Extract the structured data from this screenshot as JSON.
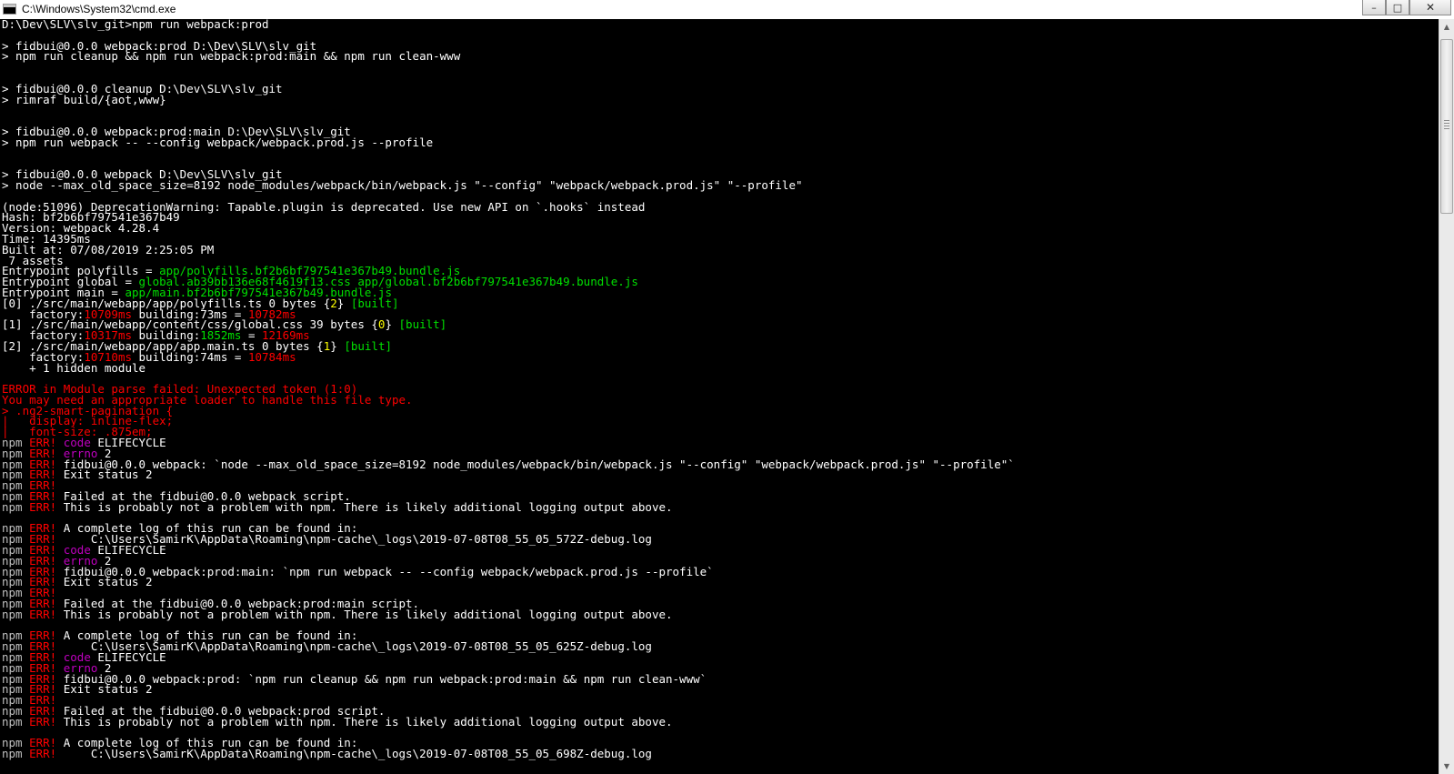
{
  "window": {
    "title": "C:\\Windows\\System32\\cmd.exe",
    "icon": "cmd-console-icon",
    "controls": {
      "minimize": "–",
      "maximize": "□",
      "close": "✕"
    }
  },
  "colors": {
    "background": "#000000",
    "default_text": "#c0c0c0",
    "bright_text": "#ffffff",
    "green": "#00e000",
    "red": "#ff0000",
    "yellow": "#ffff00",
    "magenta": "#c000c0"
  },
  "console": {
    "lines": [
      [
        [
          "w",
          "D:\\Dev\\SLV\\slv_git>npm run webpack:prod"
        ]
      ],
      [],
      [
        [
          "w",
          "> fidbui@0.0.0 webpack:prod D:\\Dev\\SLV\\slv_git"
        ]
      ],
      [
        [
          "w",
          "> npm run cleanup && npm run webpack:prod:main && npm run clean-www"
        ]
      ],
      [],
      [],
      [
        [
          "w",
          "> fidbui@0.0.0 cleanup D:\\Dev\\SLV\\slv_git"
        ]
      ],
      [
        [
          "w",
          "> rimraf build/{aot,www}"
        ]
      ],
      [],
      [],
      [
        [
          "w",
          "> fidbui@0.0.0 webpack:prod:main D:\\Dev\\SLV\\slv_git"
        ]
      ],
      [
        [
          "w",
          "> npm run webpack -- --config webpack/webpack.prod.js --profile"
        ]
      ],
      [],
      [],
      [
        [
          "w",
          "> fidbui@0.0.0 webpack D:\\Dev\\SLV\\slv_git"
        ]
      ],
      [
        [
          "w",
          "> node --max_old_space_size=8192 node_modules/webpack/bin/webpack.js \"--config\" \"webpack/webpack.prod.js\" \"--profile\""
        ]
      ],
      [],
      [
        [
          "w",
          "(node:51096) DeprecationWarning: Tapable.plugin is deprecated. Use new API on `.hooks` instead"
        ]
      ],
      [
        [
          "w",
          "Hash: bf2b6bf797541e367b49"
        ]
      ],
      [
        [
          "w",
          "Version: webpack 4.28.4"
        ]
      ],
      [
        [
          "w",
          "Time: 14395ms"
        ]
      ],
      [
        [
          "w",
          "Built at: 07/08/2019 2:25:05 PM"
        ]
      ],
      [
        [
          "w",
          " 7 assets"
        ]
      ],
      [
        [
          "w",
          "Entrypoint polyfills = "
        ],
        [
          "g",
          "app/polyfills.bf2b6bf797541e367b49.bundle.js"
        ]
      ],
      [
        [
          "w",
          "Entrypoint global = "
        ],
        [
          "g",
          "global.ab39bb136e68f4619f13.css app/global.bf2b6bf797541e367b49.bundle.js"
        ]
      ],
      [
        [
          "w",
          "Entrypoint main = "
        ],
        [
          "g",
          "app/main.bf2b6bf797541e367b49.bundle.js"
        ]
      ],
      [
        [
          "w",
          "[0] ./src/main/webapp/app/polyfills.ts 0 bytes {"
        ],
        [
          "y",
          "2"
        ],
        [
          "w",
          "} "
        ],
        [
          "g",
          "[built]"
        ]
      ],
      [
        [
          "w",
          "    factory:"
        ],
        [
          "r",
          "10709ms"
        ],
        [
          "w",
          " building:73ms = "
        ],
        [
          "r",
          "10782ms"
        ]
      ],
      [
        [
          "w",
          "[1] ./src/main/webapp/content/css/global.css 39 bytes {"
        ],
        [
          "y",
          "0"
        ],
        [
          "w",
          "} "
        ],
        [
          "g",
          "[built]"
        ]
      ],
      [
        [
          "w",
          "    factory:"
        ],
        [
          "r",
          "10317ms"
        ],
        [
          "w",
          " building:"
        ],
        [
          "g",
          "1852ms"
        ],
        [
          "w",
          " = "
        ],
        [
          "r",
          "12169ms"
        ]
      ],
      [
        [
          "w",
          "[2] ./src/main/webapp/app/app.main.ts 0 bytes {"
        ],
        [
          "y",
          "1"
        ],
        [
          "w",
          "} "
        ],
        [
          "g",
          "[built]"
        ]
      ],
      [
        [
          "w",
          "    factory:"
        ],
        [
          "r",
          "10710ms"
        ],
        [
          "w",
          " building:74ms = "
        ],
        [
          "r",
          "10784ms"
        ]
      ],
      [
        [
          "w",
          "    + 1 hidden module"
        ]
      ],
      [],
      [
        [
          "r",
          "ERROR in Module parse failed: Unexpected token (1:0)"
        ]
      ],
      [
        [
          "r",
          "You may need an appropriate loader to handle this file type."
        ]
      ],
      [
        [
          "r",
          "> .ng2-smart-pagination {"
        ]
      ],
      [
        [
          "r",
          "|   display: inline-flex;"
        ]
      ],
      [
        [
          "r",
          "|   font-size: .875em;"
        ]
      ],
      [
        [
          "gy",
          "npm "
        ],
        [
          "r",
          "ERR!"
        ],
        [
          "w",
          " "
        ],
        [
          "m",
          "code"
        ],
        [
          "w",
          " ELIFECYCLE"
        ]
      ],
      [
        [
          "gy",
          "npm "
        ],
        [
          "r",
          "ERR!"
        ],
        [
          "w",
          " "
        ],
        [
          "m",
          "errno"
        ],
        [
          "w",
          " 2"
        ]
      ],
      [
        [
          "gy",
          "npm "
        ],
        [
          "r",
          "ERR!"
        ],
        [
          "w",
          " fidbui@0.0.0 webpack: `node --max_old_space_size=8192 node_modules/webpack/bin/webpack.js \"--config\" \"webpack/webpack.prod.js\" \"--profile\"`"
        ]
      ],
      [
        [
          "gy",
          "npm "
        ],
        [
          "r",
          "ERR!"
        ],
        [
          "w",
          " Exit status 2"
        ]
      ],
      [
        [
          "gy",
          "npm "
        ],
        [
          "r",
          "ERR!"
        ]
      ],
      [
        [
          "gy",
          "npm "
        ],
        [
          "r",
          "ERR!"
        ],
        [
          "w",
          " Failed at the fidbui@0.0.0 webpack script."
        ]
      ],
      [
        [
          "gy",
          "npm "
        ],
        [
          "r",
          "ERR!"
        ],
        [
          "w",
          " This is probably not a problem with npm. There is likely additional logging output above."
        ]
      ],
      [],
      [
        [
          "gy",
          "npm "
        ],
        [
          "r",
          "ERR!"
        ],
        [
          "w",
          " A complete log of this run can be found in:"
        ]
      ],
      [
        [
          "gy",
          "npm "
        ],
        [
          "r",
          "ERR!"
        ],
        [
          "w",
          "     C:\\Users\\SamirK\\AppData\\Roaming\\npm-cache\\_logs\\2019-07-08T08_55_05_572Z-debug.log"
        ]
      ],
      [
        [
          "gy",
          "npm "
        ],
        [
          "r",
          "ERR!"
        ],
        [
          "w",
          " "
        ],
        [
          "m",
          "code"
        ],
        [
          "w",
          " ELIFECYCLE"
        ]
      ],
      [
        [
          "gy",
          "npm "
        ],
        [
          "r",
          "ERR!"
        ],
        [
          "w",
          " "
        ],
        [
          "m",
          "errno"
        ],
        [
          "w",
          " 2"
        ]
      ],
      [
        [
          "gy",
          "npm "
        ],
        [
          "r",
          "ERR!"
        ],
        [
          "w",
          " fidbui@0.0.0 webpack:prod:main: `npm run webpack -- --config webpack/webpack.prod.js --profile`"
        ]
      ],
      [
        [
          "gy",
          "npm "
        ],
        [
          "r",
          "ERR!"
        ],
        [
          "w",
          " Exit status 2"
        ]
      ],
      [
        [
          "gy",
          "npm "
        ],
        [
          "r",
          "ERR!"
        ]
      ],
      [
        [
          "gy",
          "npm "
        ],
        [
          "r",
          "ERR!"
        ],
        [
          "w",
          " Failed at the fidbui@0.0.0 webpack:prod:main script."
        ]
      ],
      [
        [
          "gy",
          "npm "
        ],
        [
          "r",
          "ERR!"
        ],
        [
          "w",
          " This is probably not a problem with npm. There is likely additional logging output above."
        ]
      ],
      [],
      [
        [
          "gy",
          "npm "
        ],
        [
          "r",
          "ERR!"
        ],
        [
          "w",
          " A complete log of this run can be found in:"
        ]
      ],
      [
        [
          "gy",
          "npm "
        ],
        [
          "r",
          "ERR!"
        ],
        [
          "w",
          "     C:\\Users\\SamirK\\AppData\\Roaming\\npm-cache\\_logs\\2019-07-08T08_55_05_625Z-debug.log"
        ]
      ],
      [
        [
          "gy",
          "npm "
        ],
        [
          "r",
          "ERR!"
        ],
        [
          "w",
          " "
        ],
        [
          "m",
          "code"
        ],
        [
          "w",
          " ELIFECYCLE"
        ]
      ],
      [
        [
          "gy",
          "npm "
        ],
        [
          "r",
          "ERR!"
        ],
        [
          "w",
          " "
        ],
        [
          "m",
          "errno"
        ],
        [
          "w",
          " 2"
        ]
      ],
      [
        [
          "gy",
          "npm "
        ],
        [
          "r",
          "ERR!"
        ],
        [
          "w",
          " fidbui@0.0.0 webpack:prod: `npm run cleanup && npm run webpack:prod:main && npm run clean-www`"
        ]
      ],
      [
        [
          "gy",
          "npm "
        ],
        [
          "r",
          "ERR!"
        ],
        [
          "w",
          " Exit status 2"
        ]
      ],
      [
        [
          "gy",
          "npm "
        ],
        [
          "r",
          "ERR!"
        ]
      ],
      [
        [
          "gy",
          "npm "
        ],
        [
          "r",
          "ERR!"
        ],
        [
          "w",
          " Failed at the fidbui@0.0.0 webpack:prod script."
        ]
      ],
      [
        [
          "gy",
          "npm "
        ],
        [
          "r",
          "ERR!"
        ],
        [
          "w",
          " This is probably not a problem with npm. There is likely additional logging output above."
        ]
      ],
      [],
      [
        [
          "gy",
          "npm "
        ],
        [
          "r",
          "ERR!"
        ],
        [
          "w",
          " A complete log of this run can be found in:"
        ]
      ],
      [
        [
          "gy",
          "npm "
        ],
        [
          "r",
          "ERR!"
        ],
        [
          "w",
          "     C:\\Users\\SamirK\\AppData\\Roaming\\npm-cache\\_logs\\2019-07-08T08_55_05_698Z-debug.log"
        ]
      ]
    ]
  },
  "scrollbar": {
    "up_arrow": "▲",
    "down_arrow": "▼",
    "thumb_position_fraction": 0.0
  }
}
